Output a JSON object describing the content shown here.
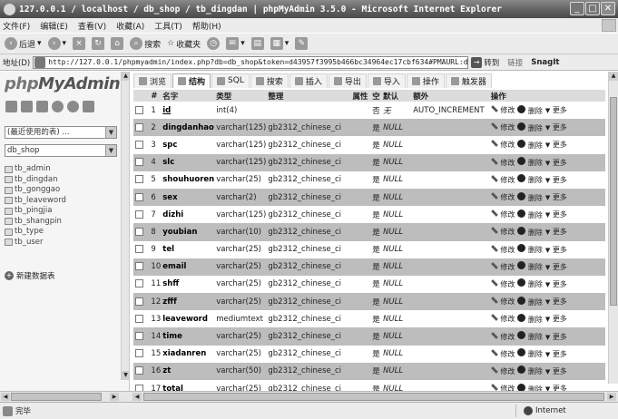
{
  "window": {
    "title": "127.0.0.1 / localhost / db_shop / tb_dingdan | phpMyAdmin 3.5.0 - Microsoft Internet Explorer",
    "buttons": {
      "minimize": "_",
      "maximize": "□",
      "close": "✕"
    }
  },
  "menubar": {
    "items": [
      "文件(F)",
      "编辑(E)",
      "查看(V)",
      "收藏(A)",
      "工具(T)",
      "帮助(H)"
    ]
  },
  "toolbar": {
    "back": "后退",
    "search": "搜索",
    "favorites": "收藏夹"
  },
  "addressbar": {
    "label": "地址(D)",
    "url": "http://127.0.0.1/phpmyadmin/index.php?db=db_shop&token=d43957f3995b466bc34964ec17cbf634#PMAURL:db=db_shop&table=tb_d",
    "go": "转到",
    "links": "链接",
    "snagit": "SnagIt"
  },
  "sidebar": {
    "logo_php": "php",
    "logo_rest": "MyAdmin",
    "recent_select": "(最近使用的表) ...",
    "db_select": "db_shop",
    "tables": [
      "tb_admin",
      "tb_dingdan",
      "tb_gonggao",
      "tb_leaveword",
      "tb_pingjia",
      "tb_shangpin",
      "tb_type",
      "tb_user"
    ],
    "new_table": "新建数据表"
  },
  "tabs": [
    {
      "label": "浏览",
      "active": false
    },
    {
      "label": "结构",
      "active": true
    },
    {
      "label": "SQL",
      "active": false
    },
    {
      "label": "搜索",
      "active": false
    },
    {
      "label": "插入",
      "active": false
    },
    {
      "label": "导出",
      "active": false
    },
    {
      "label": "导入",
      "active": false
    },
    {
      "label": "操作",
      "active": false
    },
    {
      "label": "触发器",
      "active": false
    }
  ],
  "structure": {
    "headers": {
      "num": "#",
      "name": "名字",
      "type": "类型",
      "collation": "整理",
      "attributes": "属性",
      "null": "空",
      "default": "默认",
      "extra": "额外",
      "actions": "操作"
    },
    "rows": [
      {
        "num": "1",
        "name": "id",
        "type": "int(4)",
        "collation": "",
        "attributes": "",
        "null": "否",
        "default": "无",
        "extra": "AUTO_INCREMENT",
        "primary": true
      },
      {
        "num": "2",
        "name": "dingdanhao",
        "type": "varchar(125)",
        "collation": "gb2312_chinese_ci",
        "attributes": "",
        "null": "是",
        "default": "NULL",
        "extra": ""
      },
      {
        "num": "3",
        "name": "spc",
        "type": "varchar(125)",
        "collation": "gb2312_chinese_ci",
        "attributes": "",
        "null": "是",
        "default": "NULL",
        "extra": ""
      },
      {
        "num": "4",
        "name": "slc",
        "type": "varchar(125)",
        "collation": "gb2312_chinese_ci",
        "attributes": "",
        "null": "是",
        "default": "NULL",
        "extra": ""
      },
      {
        "num": "5",
        "name": "shouhuoren",
        "type": "varchar(25)",
        "collation": "gb2312_chinese_ci",
        "attributes": "",
        "null": "是",
        "default": "NULL",
        "extra": ""
      },
      {
        "num": "6",
        "name": "sex",
        "type": "varchar(2)",
        "collation": "gb2312_chinese_ci",
        "attributes": "",
        "null": "是",
        "default": "NULL",
        "extra": ""
      },
      {
        "num": "7",
        "name": "dizhi",
        "type": "varchar(125)",
        "collation": "gb2312_chinese_ci",
        "attributes": "",
        "null": "是",
        "default": "NULL",
        "extra": ""
      },
      {
        "num": "8",
        "name": "youbian",
        "type": "varchar(10)",
        "collation": "gb2312_chinese_ci",
        "attributes": "",
        "null": "是",
        "default": "NULL",
        "extra": ""
      },
      {
        "num": "9",
        "name": "tel",
        "type": "varchar(25)",
        "collation": "gb2312_chinese_ci",
        "attributes": "",
        "null": "是",
        "default": "NULL",
        "extra": ""
      },
      {
        "num": "10",
        "name": "email",
        "type": "varchar(25)",
        "collation": "gb2312_chinese_ci",
        "attributes": "",
        "null": "是",
        "default": "NULL",
        "extra": ""
      },
      {
        "num": "11",
        "name": "shff",
        "type": "varchar(25)",
        "collation": "gb2312_chinese_ci",
        "attributes": "",
        "null": "是",
        "default": "NULL",
        "extra": ""
      },
      {
        "num": "12",
        "name": "zfff",
        "type": "varchar(25)",
        "collation": "gb2312_chinese_ci",
        "attributes": "",
        "null": "是",
        "default": "NULL",
        "extra": ""
      },
      {
        "num": "13",
        "name": "leaveword",
        "type": "mediumtext",
        "collation": "gb2312_chinese_ci",
        "attributes": "",
        "null": "是",
        "default": "NULL",
        "extra": ""
      },
      {
        "num": "14",
        "name": "time",
        "type": "varchar(25)",
        "collation": "gb2312_chinese_ci",
        "attributes": "",
        "null": "是",
        "default": "NULL",
        "extra": ""
      },
      {
        "num": "15",
        "name": "xiadanren",
        "type": "varchar(25)",
        "collation": "gb2312_chinese_ci",
        "attributes": "",
        "null": "是",
        "default": "NULL",
        "extra": ""
      },
      {
        "num": "16",
        "name": "zt",
        "type": "varchar(50)",
        "collation": "gb2312_chinese_ci",
        "attributes": "",
        "null": "是",
        "default": "NULL",
        "extra": ""
      },
      {
        "num": "17",
        "name": "total",
        "type": "varchar(25)",
        "collation": "gb2312_chinese_ci",
        "attributes": "",
        "null": "是",
        "default": "NULL",
        "extra": ""
      }
    ],
    "action_labels": {
      "edit": "修改",
      "delete": "删除",
      "more": "更多"
    }
  },
  "statusbar": {
    "text": "完毕",
    "zone": "Internet"
  },
  "icons": {
    "back": "back-arrow-icon",
    "forward": "forward-arrow-icon",
    "stop": "stop-icon",
    "refresh": "refresh-icon",
    "home": "home-icon",
    "search": "search-icon",
    "favorites": "star-icon",
    "history": "history-icon",
    "mail": "mail-icon",
    "print": "print-icon"
  }
}
